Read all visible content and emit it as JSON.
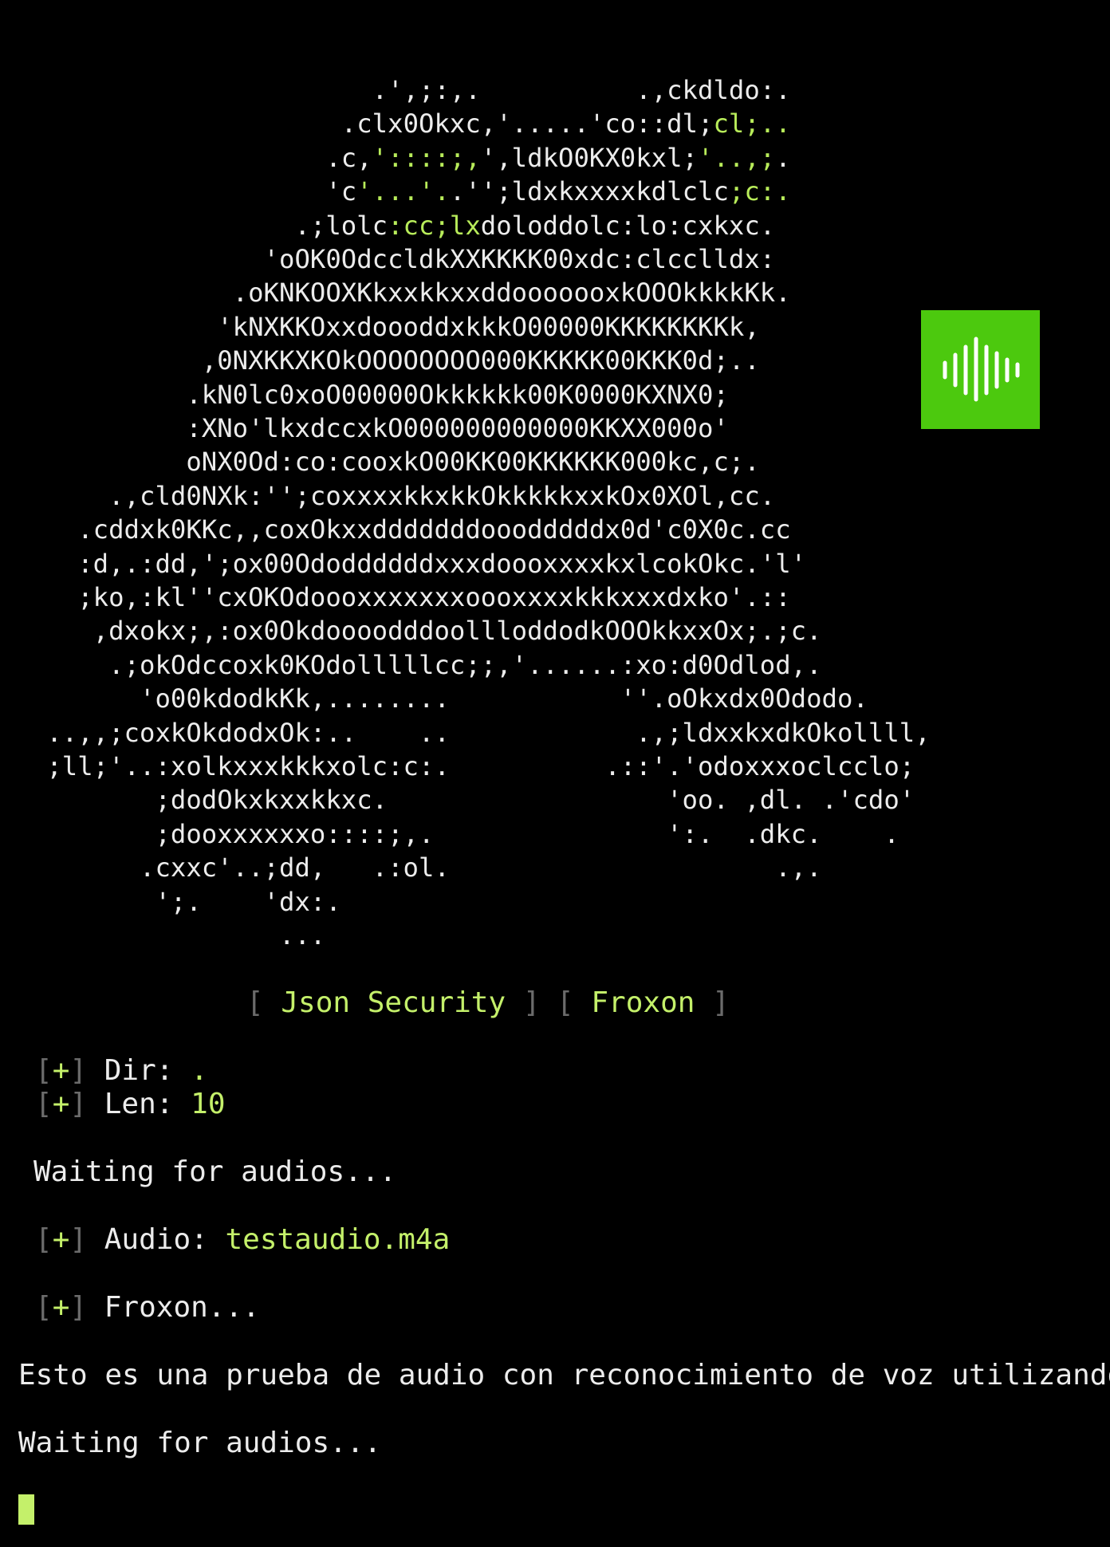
{
  "ascii_art": {
    "lines": [
      "                        .',;:,.          .,ckdldo:.",
      "                      .clx0Okxc,'.....'co::dl;cl;..",
      "                     .c,'::::;,',ldkO0KX0kxl;'..,;.",
      "                     'c'...'..'';ldxkxxxxkdlclc;c:.",
      "                   .;lolc:cc;lxdoloddolc:lo:cxkxc.",
      "                 'oOK0OdccldkXXKKKK00xdc:clcclldx:",
      "               .oKNKOOXKkxxkkxxddooooooxkOOOkkkkKk.",
      "              'kNXKKOxxdoooddxkkkO00000KKKKKKKKk,",
      "             ,0NXKKXKOkOOOOOOOO000KKKKK00KKK0d;..",
      "            .kN0lc0xoO00000Okkkkkk00K0000KXNX0;",
      "            :XNo'lkxdccxkO000000000000KKXX000o'",
      "            oNX0Od:co:cooxkO00KK00KKKKKK000kc,c;.",
      "       .,cld0NXk:'';coxxxxkkxkkOkkkkkxxkOx0XOl,cc.",
      "     .cddxk0KKc,,coxOkxxdddddddooodddddx0d'c0X0c.cc",
      "     :d,.:dd,';ox00OdoddddddxxxdoooxxxxkxlcokOkc.'l'",
      "     ;ko,:kl''cxOKOdoooxxxxxxxoooxxxxkkkxxxdxko'.::",
      "      ,dxokx;,:ox0OkdoooodddoollloddodkOOOkkxxOx;.;c.",
      "       .;okOdccoxk0KOdolllllcc;;,'......:xo:d0Odlod,.",
      "         'o00kdodkKk,........           ''.oOkxdx0Ododo.",
      "   ..,,;coxkOkdodxOk:..    ..            .,;ldxxkxdkOkollll,",
      "   ;ll;'..:xolkxxxkkkxolc:c:.          .::'.'odoxxxoclcclo;",
      "          ;dodOkxkxxkkxc.                  'oo. ,dl. .'cdo'",
      "          ;dooxxxxxxo::::;,.               ':.  .dkc.    .",
      "         .cxxc'..;dd,   .:ol.                     .,.",
      "          ';.    'dx:.",
      "                  ..."
    ]
  },
  "banner": {
    "open_bracket": "[",
    "close_bracket": "]",
    "item1": "Json Security",
    "item2": "Froxon"
  },
  "output": {
    "plus_marker": "+",
    "dir_label": "Dir:",
    "dir_value": ".",
    "len_label": "Len:",
    "len_value": "10",
    "waiting_1": "Waiting for audios...",
    "audio_label": "Audio:",
    "audio_file": "testaudio.m4a",
    "froxon_status": "Froxon...",
    "transcript": "Esto es una prueba de audio con reconocimiento de voz utilizando la",
    "waiting_2": "Waiting for audios..."
  },
  "colors": {
    "background": "#000000",
    "accent": "#c4f06a",
    "text": "#ececec",
    "bracket": "#6b6b6b",
    "logo_tile": "#4cc90e"
  },
  "icons": {
    "logo": "audio-waveform-icon"
  }
}
